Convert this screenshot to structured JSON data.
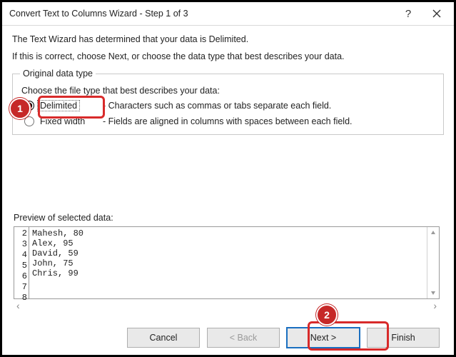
{
  "title": "Convert Text to Columns Wizard - Step 1 of 3",
  "intro": {
    "line1": "The Text Wizard has determined that your data is Delimited.",
    "line2": "If this is correct, choose Next, or choose the data type that best describes your data."
  },
  "group": {
    "legend": "Original data type",
    "prompt": "Choose the file type that best describes your data:",
    "options": [
      {
        "label": "Delimited",
        "desc": "- Characters such as commas or tabs separate each field.",
        "selected": true
      },
      {
        "label": "Fixed width",
        "desc": "- Fields are aligned in columns with spaces between each field.",
        "selected": false
      }
    ]
  },
  "preview": {
    "label": "Preview of selected data:",
    "rows": [
      {
        "n": "2",
        "text": "Mahesh, 80"
      },
      {
        "n": "3",
        "text": "Alex, 95"
      },
      {
        "n": "4",
        "text": "David, 59"
      },
      {
        "n": "5",
        "text": "John, 75"
      },
      {
        "n": "6",
        "text": "Chris, 99"
      },
      {
        "n": "7",
        "text": ""
      },
      {
        "n": "8",
        "text": ""
      }
    ],
    "text": "Mahesh, 80\nAlex, 95\nDavid, 59\nJohn, 75\nChris, 99\n\n"
  },
  "buttons": {
    "cancel": "Cancel",
    "back": "< Back",
    "next": "Next >",
    "finish": "Finish"
  },
  "annotations": [
    "1",
    "2"
  ]
}
